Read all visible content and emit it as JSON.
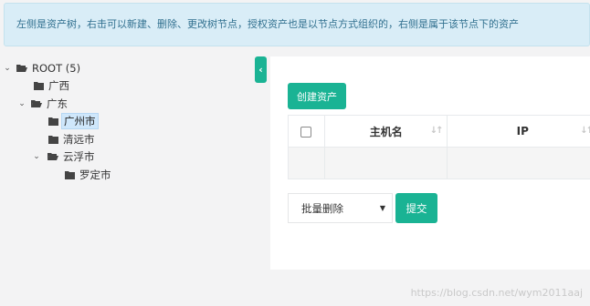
{
  "alert": {
    "text": "左侧是资产树，右击可以新建、删除、更改树节点，授权资产也是以节点方式组织的，右侧是属于该节点下的资产"
  },
  "tree": {
    "root": {
      "label": "ROOT (5)"
    },
    "guangxi": {
      "label": "广西"
    },
    "guangdong": {
      "label": "广东"
    },
    "guangzhou": {
      "label": "广州市"
    },
    "qingyuan": {
      "label": "清远市"
    },
    "yunfu": {
      "label": "云浮市"
    },
    "luoding": {
      "label": "罗定市"
    }
  },
  "sidebar_toggle": {
    "glyph": "‹"
  },
  "toolbar": {
    "create_label": "创建资产"
  },
  "table": {
    "columns": [
      "主机名",
      "IP"
    ],
    "sort_glyph": "↓↑"
  },
  "bulk": {
    "selected": "批量删除",
    "arrow": "▼",
    "submit_label": "提交"
  },
  "watermark": "https://blog.csdn.net/wym2011aaj",
  "colors": {
    "accent": "#1ab394",
    "alert_bg": "#d9edf7",
    "selected_bg": "#cfe7fb"
  }
}
